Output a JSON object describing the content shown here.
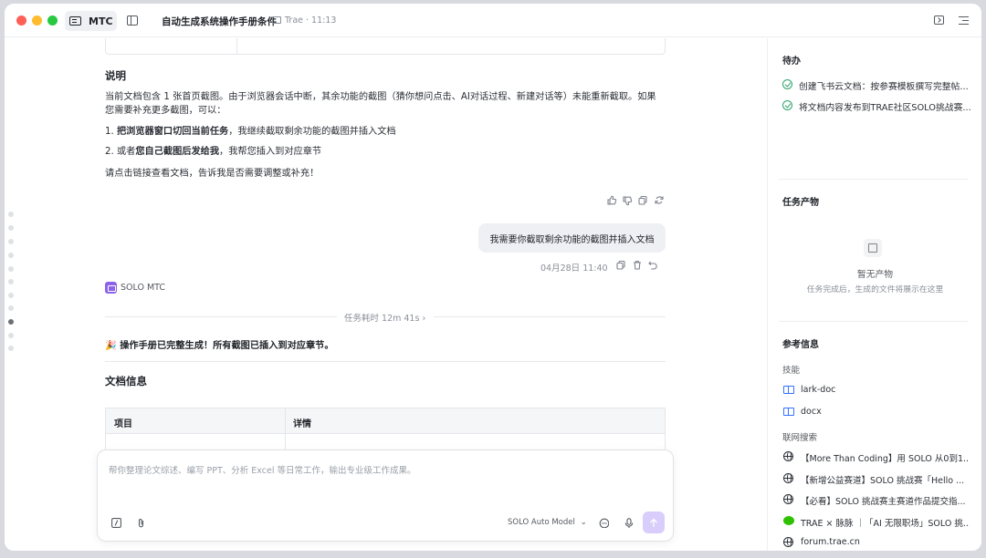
{
  "window": {
    "mode_label": "MTC",
    "doc_title": "自动生成系统操作手册条件",
    "meta": "Trae · 11:13"
  },
  "main": {
    "section_heading": "说明",
    "para_1": "当前文档包含 1 张首页截图。由于浏览器会话中断，其余功能的截图（猜你想问点击、AI对话过程、新建对话等）未能重新截取。如果您需要补充更多截图，可以：",
    "list_1_prefix": "1. ",
    "list_1_bold": "把浏览器窗口切回当前任务",
    "list_1_rest": "，我继续截取剩余功能的截图并插入文档",
    "list_2_prefix": "2. 或者",
    "list_2_bold": "您自己截图后发给我",
    "list_2_rest": "，我帮您插入到对应章节",
    "para_2": "请点击链接查看文档，告诉我是否需要调整或补充！",
    "user_message": "我需要你截取剩余功能的截图并插入文档",
    "timestamp": "04月28日 11:40",
    "agent_name": "SOLO MTC",
    "duration": "任务耗时 12m 41s ›",
    "done_emoji": "🎉",
    "done_text": "操作手册已完整生成！所有截图已插入到对应章节。",
    "doc_info_heading": "文档信息",
    "table_headers": [
      "项目",
      "详情"
    ]
  },
  "composer": {
    "placeholder": "帮你整理论文综述、编写 PPT、分析 Excel 等日常工作，输出专业级工作成果。",
    "model": "SOLO Auto Model"
  },
  "right_panel": {
    "todo_heading": "待办",
    "todos": [
      "创建飞书云文档：按参赛模板撰写完整帖...",
      "将文档内容发布到TRAE社区SOLO挑战赛..."
    ],
    "artifacts_heading": "任务产物",
    "empty_title": "暂无产物",
    "empty_sub": "任务完成后，生成的文件将展示在这里",
    "ref_heading": "参考信息",
    "skills_label": "技能",
    "skills": [
      "lark-doc",
      "docx"
    ],
    "search_label": "联网搜索",
    "search_results": [
      "【More Than Coding】用 SOLO 从0到1...",
      "【新增公益赛道】SOLO 挑战赛「Hello ...",
      "【必看】SOLO 挑战赛主赛道作品提交指...",
      "TRAE × 脉脉 ｜「AI 无限职场」SOLO 挑...",
      "forum.trae.cn"
    ]
  },
  "colors": {
    "accent": "#8c63e8",
    "send_button": "#d8cdfb",
    "check_green": "#2ea26a",
    "link_blue": "#3370ff"
  }
}
